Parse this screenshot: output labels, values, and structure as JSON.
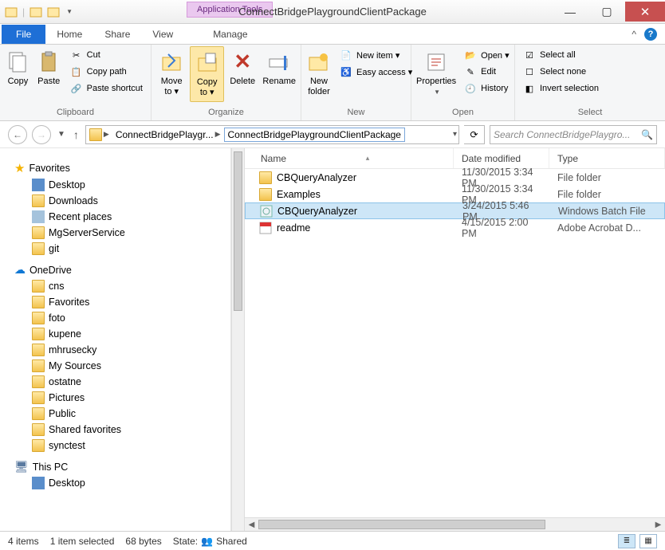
{
  "window": {
    "title": "ConnectBridgePlaygroundClientPackage",
    "context_tab": "Application Tools"
  },
  "tabs": {
    "file": "File",
    "home": "Home",
    "share": "Share",
    "view": "View",
    "manage": "Manage"
  },
  "ribbon": {
    "copy": "Copy",
    "paste": "Paste",
    "cut": "Cut",
    "copy_path": "Copy path",
    "paste_shortcut": "Paste shortcut",
    "clipboard": "Clipboard",
    "move_to": "Move to ▾",
    "copy_to": "Copy to ▾",
    "delete": "Delete",
    "rename": "Rename",
    "organize": "Organize",
    "new_folder": "New folder",
    "new_item": "New item ▾",
    "easy_access": "Easy access ▾",
    "new": "New",
    "properties": "Properties",
    "open": "Open ▾",
    "edit": "Edit",
    "history": "History",
    "open_grp": "Open",
    "select_all": "Select all",
    "select_none": "Select none",
    "invert_selection": "Invert selection",
    "select": "Select"
  },
  "breadcrumb": {
    "seg1": "ConnectBridgePlaygr...",
    "seg2": "ConnectBridgePlaygroundClientPackage"
  },
  "search": {
    "placeholder": "Search ConnectBridgePlaygro..."
  },
  "tree": {
    "favorites": "Favorites",
    "desktop": "Desktop",
    "downloads": "Downloads",
    "recent_places": "Recent places",
    "mg": "MgServerService",
    "git": "git",
    "onedrive": "OneDrive",
    "cns": "cns",
    "favorites2": "Favorites",
    "foto": "foto",
    "kupene": "kupene",
    "mhrusecky": "mhrusecky",
    "mysources": "My Sources",
    "ostatne": "ostatne",
    "pictures": "Pictures",
    "public": "Public",
    "shared_fav": "Shared favorites",
    "synctest": "synctest",
    "thispc": "This PC",
    "desktop2": "Desktop"
  },
  "columns": {
    "name": "Name",
    "date": "Date modified",
    "type": "Type"
  },
  "files": [
    {
      "name": "CBQueryAnalyzer",
      "date": "11/30/2015 3:34 PM",
      "type": "File folder",
      "icon": "folder"
    },
    {
      "name": "Examples",
      "date": "11/30/2015 3:34 PM",
      "type": "File folder",
      "icon": "folder"
    },
    {
      "name": "CBQueryAnalyzer",
      "date": "3/24/2015 5:46 PM",
      "type": "Windows Batch File",
      "icon": "batch",
      "selected": true
    },
    {
      "name": "readme",
      "date": "4/15/2015 2:00 PM",
      "type": "Adobe Acrobat D...",
      "icon": "pdf"
    }
  ],
  "status": {
    "items": "4 items",
    "selected": "1 item selected",
    "size": "68 bytes",
    "state_label": "State:",
    "state_value": "Shared"
  }
}
